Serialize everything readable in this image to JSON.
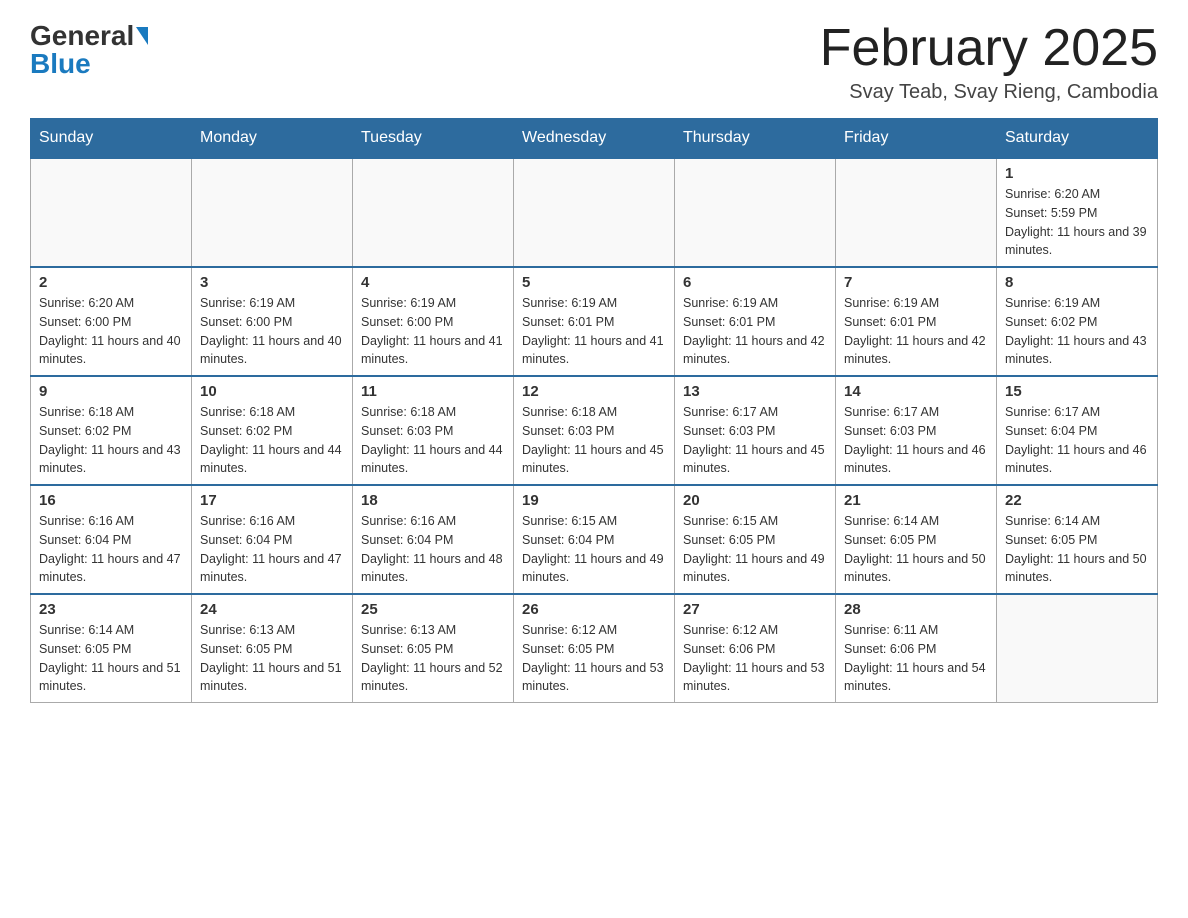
{
  "header": {
    "logo_general": "General",
    "logo_blue": "Blue",
    "title": "February 2025",
    "subtitle": "Svay Teab, Svay Rieng, Cambodia"
  },
  "days_of_week": [
    "Sunday",
    "Monday",
    "Tuesday",
    "Wednesday",
    "Thursday",
    "Friday",
    "Saturday"
  ],
  "weeks": [
    [
      {
        "day": "",
        "info": ""
      },
      {
        "day": "",
        "info": ""
      },
      {
        "day": "",
        "info": ""
      },
      {
        "day": "",
        "info": ""
      },
      {
        "day": "",
        "info": ""
      },
      {
        "day": "",
        "info": ""
      },
      {
        "day": "1",
        "info": "Sunrise: 6:20 AM\nSunset: 5:59 PM\nDaylight: 11 hours and 39 minutes."
      }
    ],
    [
      {
        "day": "2",
        "info": "Sunrise: 6:20 AM\nSunset: 6:00 PM\nDaylight: 11 hours and 40 minutes."
      },
      {
        "day": "3",
        "info": "Sunrise: 6:19 AM\nSunset: 6:00 PM\nDaylight: 11 hours and 40 minutes."
      },
      {
        "day": "4",
        "info": "Sunrise: 6:19 AM\nSunset: 6:00 PM\nDaylight: 11 hours and 41 minutes."
      },
      {
        "day": "5",
        "info": "Sunrise: 6:19 AM\nSunset: 6:01 PM\nDaylight: 11 hours and 41 minutes."
      },
      {
        "day": "6",
        "info": "Sunrise: 6:19 AM\nSunset: 6:01 PM\nDaylight: 11 hours and 42 minutes."
      },
      {
        "day": "7",
        "info": "Sunrise: 6:19 AM\nSunset: 6:01 PM\nDaylight: 11 hours and 42 minutes."
      },
      {
        "day": "8",
        "info": "Sunrise: 6:19 AM\nSunset: 6:02 PM\nDaylight: 11 hours and 43 minutes."
      }
    ],
    [
      {
        "day": "9",
        "info": "Sunrise: 6:18 AM\nSunset: 6:02 PM\nDaylight: 11 hours and 43 minutes."
      },
      {
        "day": "10",
        "info": "Sunrise: 6:18 AM\nSunset: 6:02 PM\nDaylight: 11 hours and 44 minutes."
      },
      {
        "day": "11",
        "info": "Sunrise: 6:18 AM\nSunset: 6:03 PM\nDaylight: 11 hours and 44 minutes."
      },
      {
        "day": "12",
        "info": "Sunrise: 6:18 AM\nSunset: 6:03 PM\nDaylight: 11 hours and 45 minutes."
      },
      {
        "day": "13",
        "info": "Sunrise: 6:17 AM\nSunset: 6:03 PM\nDaylight: 11 hours and 45 minutes."
      },
      {
        "day": "14",
        "info": "Sunrise: 6:17 AM\nSunset: 6:03 PM\nDaylight: 11 hours and 46 minutes."
      },
      {
        "day": "15",
        "info": "Sunrise: 6:17 AM\nSunset: 6:04 PM\nDaylight: 11 hours and 46 minutes."
      }
    ],
    [
      {
        "day": "16",
        "info": "Sunrise: 6:16 AM\nSunset: 6:04 PM\nDaylight: 11 hours and 47 minutes."
      },
      {
        "day": "17",
        "info": "Sunrise: 6:16 AM\nSunset: 6:04 PM\nDaylight: 11 hours and 47 minutes."
      },
      {
        "day": "18",
        "info": "Sunrise: 6:16 AM\nSunset: 6:04 PM\nDaylight: 11 hours and 48 minutes."
      },
      {
        "day": "19",
        "info": "Sunrise: 6:15 AM\nSunset: 6:04 PM\nDaylight: 11 hours and 49 minutes."
      },
      {
        "day": "20",
        "info": "Sunrise: 6:15 AM\nSunset: 6:05 PM\nDaylight: 11 hours and 49 minutes."
      },
      {
        "day": "21",
        "info": "Sunrise: 6:14 AM\nSunset: 6:05 PM\nDaylight: 11 hours and 50 minutes."
      },
      {
        "day": "22",
        "info": "Sunrise: 6:14 AM\nSunset: 6:05 PM\nDaylight: 11 hours and 50 minutes."
      }
    ],
    [
      {
        "day": "23",
        "info": "Sunrise: 6:14 AM\nSunset: 6:05 PM\nDaylight: 11 hours and 51 minutes."
      },
      {
        "day": "24",
        "info": "Sunrise: 6:13 AM\nSunset: 6:05 PM\nDaylight: 11 hours and 51 minutes."
      },
      {
        "day": "25",
        "info": "Sunrise: 6:13 AM\nSunset: 6:05 PM\nDaylight: 11 hours and 52 minutes."
      },
      {
        "day": "26",
        "info": "Sunrise: 6:12 AM\nSunset: 6:05 PM\nDaylight: 11 hours and 53 minutes."
      },
      {
        "day": "27",
        "info": "Sunrise: 6:12 AM\nSunset: 6:06 PM\nDaylight: 11 hours and 53 minutes."
      },
      {
        "day": "28",
        "info": "Sunrise: 6:11 AM\nSunset: 6:06 PM\nDaylight: 11 hours and 54 minutes."
      },
      {
        "day": "",
        "info": ""
      }
    ]
  ]
}
